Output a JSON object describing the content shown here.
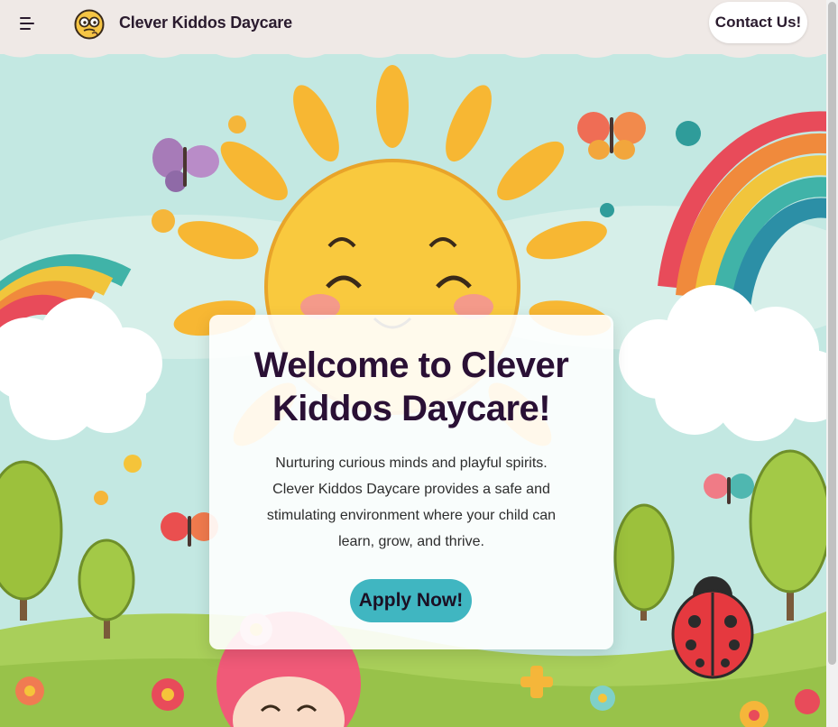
{
  "nav": {
    "menu_icon": "hamburger-menu-icon",
    "logo_icon": "thinking-face-logo",
    "brand": "Clever Kiddos Daycare",
    "contact_label": "Contact Us!"
  },
  "hero": {
    "title": "Welcome to Clever Kiddos Daycare!",
    "description": "Nurturing curious minds and playful spirits. Clever Kiddos Daycare provides a safe and stimulating environment where your child can learn, grow, and thrive.",
    "cta_label": "Apply Now!"
  },
  "colors": {
    "navbar": "#efe9e6",
    "sky": "#bfe6e0",
    "accent": "#40b6c1",
    "heading": "#2a1035",
    "sun": "#f7c43f"
  }
}
